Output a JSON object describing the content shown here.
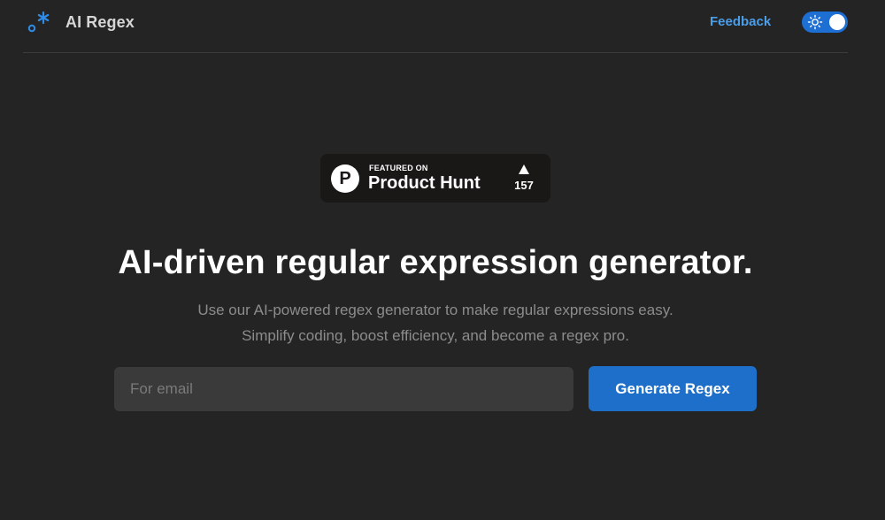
{
  "header": {
    "brand": "AI Regex",
    "logo_icon": "regex-dot-star-icon",
    "feedback_label": "Feedback",
    "theme_toggle_icon": "sun-icon"
  },
  "product_hunt": {
    "featured_label": "FEATURED ON",
    "name": "Product Hunt",
    "logo_letter": "P",
    "upvote_icon": "upvote-triangle-icon",
    "upvotes": "157"
  },
  "hero": {
    "title": "AI-driven regular expression generator.",
    "subtitle_line1": "Use our AI-powered regex generator to make regular expressions easy.",
    "subtitle_line2": "Simplify coding, boost efficiency, and become a regex pro."
  },
  "form": {
    "email_placeholder": "For email",
    "email_value": "",
    "generate_label": "Generate Regex"
  },
  "colors": {
    "background": "#242424",
    "accent": "#1e6fc9",
    "link": "#4a9eea",
    "input_background": "#3a3a3a"
  }
}
